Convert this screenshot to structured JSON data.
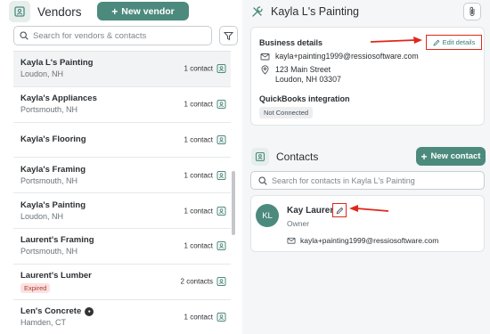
{
  "vendors_panel": {
    "title": "Vendors",
    "new_vendor_label": "New vendor",
    "search_placeholder": "Search for vendors & contacts"
  },
  "vendors": [
    {
      "name": "Kayla L's Painting",
      "location": "Loudon, NH",
      "contacts": "1 contact",
      "selected": true
    },
    {
      "name": "Kayla's Appliances",
      "location": "Portsmouth, NH",
      "contacts": "1 contact"
    },
    {
      "name": "Kayla's Flooring",
      "location": "",
      "contacts": "1 contact"
    },
    {
      "name": "Kayla's Framing",
      "location": "Portsmouth, NH",
      "contacts": "1 contact"
    },
    {
      "name": "Kayla's Painting",
      "location": "Loudon, NH",
      "contacts": "1 contact"
    },
    {
      "name": "Laurent's Framing",
      "location": "Portsmouth, NH",
      "contacts": "1 contact"
    },
    {
      "name": "Laurent's Lumber",
      "badge": "Expired",
      "contacts": "2 contacts"
    },
    {
      "name": "Len's Concrete",
      "location": "Hamden, CT",
      "contacts": "1 contact"
    }
  ],
  "detail": {
    "title": "Kayla L's Painting",
    "business_details_label": "Business details",
    "edit_details_label": "Edit details",
    "email": "kayla+painting1999@ressiosoftware.com",
    "address_line1": "123 Main Street",
    "address_line2": "Loudon, NH 03307",
    "quickbooks_label": "QuickBooks integration",
    "quickbooks_status": "Not Connected"
  },
  "contacts_section": {
    "title": "Contacts",
    "new_contact_label": "New contact",
    "search_placeholder": "Search for contacts in Kayla L's Painting"
  },
  "contact": {
    "initials": "KL",
    "name": "Kay Laurent",
    "role": "Owner",
    "email": "kayla+painting1999@ressiosoftware.com"
  },
  "colors": {
    "brand": "#4c8a7d",
    "annotation": "#e0271a",
    "expired_bg": "#fbe1df",
    "expired_text": "#b23a31"
  },
  "icons": {
    "vendors_header": "store-icon",
    "detail_header": "tools-icon",
    "contacts_header": "contacts-icon",
    "search": "search-icon",
    "filter": "filter-icon",
    "attach": "paperclip-icon",
    "edit": "pencil-icon",
    "email": "mail-icon",
    "address": "map-pin-icon"
  }
}
